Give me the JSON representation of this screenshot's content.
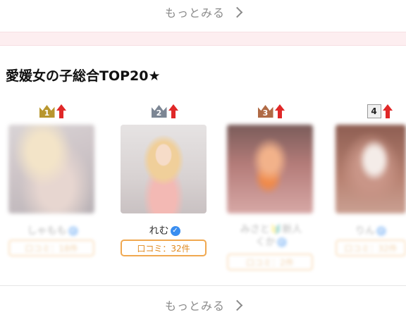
{
  "more_top": {
    "label": "もっとみる"
  },
  "section": {
    "title": "愛媛女の子総合TOP20★"
  },
  "more_bottom": {
    "label": "もっとみる"
  },
  "cards": [
    {
      "rank": "1",
      "name": "しゃもも",
      "reviews": "口コミ：18件"
    },
    {
      "rank": "2",
      "name": "れむ",
      "reviews": "口コミ：32件"
    },
    {
      "rank": "3",
      "name": "みさと🔰新人",
      "name2": "くか",
      "reviews": "口コミ：2件"
    },
    {
      "rank": "4",
      "name": "りん",
      "reviews": "口コミ：32件"
    }
  ],
  "colors": {
    "gold": "#b8962e",
    "silver": "#7c8694",
    "bronze": "#b06a45",
    "arrow": "#e02828",
    "review_border": "#f0a850",
    "verify": "#3a8ef0"
  },
  "icons": [
    "crown-icon",
    "up-arrow-icon",
    "verified-icon",
    "chevron-right-icon"
  ]
}
